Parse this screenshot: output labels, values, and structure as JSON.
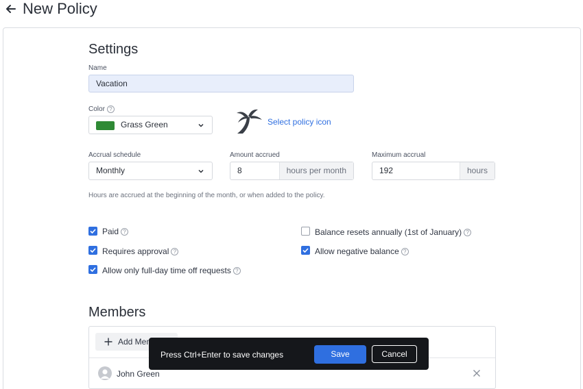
{
  "header": {
    "title": "New Policy",
    "back_icon": "arrow-left-icon"
  },
  "settings": {
    "title": "Settings",
    "name": {
      "label": "Name",
      "value": "Vacation"
    },
    "color": {
      "label": "Color",
      "value": "Grass Green",
      "swatch": "#2f8a35"
    },
    "policy_icon": {
      "icon": "palm-tree-icon",
      "link_label": "Select policy icon"
    },
    "accrual_schedule": {
      "label": "Accrual schedule",
      "value": "Monthly"
    },
    "amount_accrued": {
      "label": "Amount accrued",
      "value": "8",
      "suffix": "hours per month"
    },
    "maximum_accrual": {
      "label": "Maximum accrual",
      "value": "192",
      "suffix": "hours"
    },
    "hint": "Hours are accrued at the beginning of the month, or when added to the policy.",
    "options": {
      "paid": {
        "label": "Paid",
        "checked": true
      },
      "requires_approval": {
        "label": "Requires approval",
        "checked": true
      },
      "full_day_only": {
        "label": "Allow only full-day time off requests",
        "checked": true
      },
      "balance_resets": {
        "label": "Balance resets annually (1st of January)",
        "checked": false
      },
      "negative_balance": {
        "label": "Allow negative balance",
        "checked": true
      }
    }
  },
  "members": {
    "title": "Members",
    "add_label": "Add Members",
    "list": [
      {
        "name": "John Green"
      }
    ]
  },
  "toast": {
    "message": "Press Ctrl+Enter to save changes",
    "save_label": "Save",
    "cancel_label": "Cancel"
  },
  "colors": {
    "accent": "#2f6fe0",
    "toast_bg": "#15171b"
  }
}
